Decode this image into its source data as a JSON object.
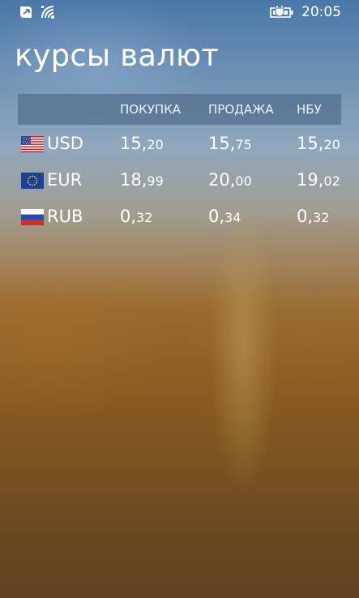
{
  "status_bar": {
    "time": "20:05",
    "icons": [
      "app-notification-icon",
      "wifi-icon",
      "battery-charging-icon"
    ]
  },
  "page": {
    "title": "курсы валют"
  },
  "table": {
    "headers": [
      "ПОКУПКА",
      "ПРОДАЖА",
      "НБУ"
    ],
    "rows": [
      {
        "flag_icon": "us-flag-icon",
        "code": "USD",
        "buy": {
          "int": "15,",
          "frac": "20"
        },
        "sell": {
          "int": "15,",
          "frac": "75"
        },
        "nbu": {
          "int": "15,",
          "frac": "20"
        }
      },
      {
        "flag_icon": "eu-flag-icon",
        "code": "EUR",
        "buy": {
          "int": "18,",
          "frac": "99"
        },
        "sell": {
          "int": "20,",
          "frac": "00"
        },
        "nbu": {
          "int": "19,",
          "frac": "02"
        }
      },
      {
        "flag_icon": "ru-flag-icon",
        "code": "RUB",
        "buy": {
          "int": "0,",
          "frac": "32"
        },
        "sell": {
          "int": "0,",
          "frac": "34"
        },
        "nbu": {
          "int": "0,",
          "frac": "32"
        }
      }
    ]
  }
}
